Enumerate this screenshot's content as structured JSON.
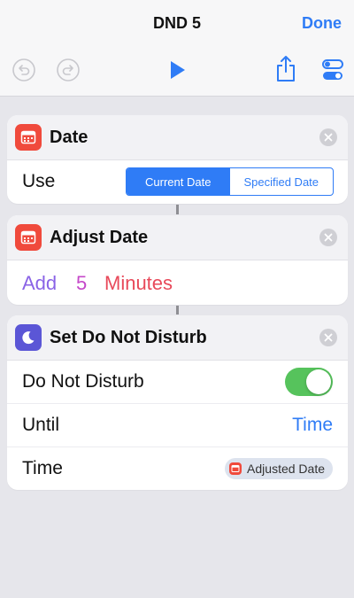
{
  "header": {
    "title": "DND 5",
    "done_label": "Done"
  },
  "toolbar": {
    "icons": [
      "undo-icon",
      "redo-icon",
      "play-icon",
      "share-icon",
      "settings-toggle-icon"
    ]
  },
  "actions": {
    "date": {
      "title": "Date",
      "icon": "calendar-icon",
      "use_label": "Use",
      "segments": [
        {
          "label": "Current Date",
          "selected": true
        },
        {
          "label": "Specified Date",
          "selected": false
        }
      ]
    },
    "adjust_date": {
      "title": "Adjust Date",
      "icon": "calendar-icon",
      "operation": "Add",
      "amount": "5",
      "unit": "Minutes"
    },
    "set_dnd": {
      "title": "Set Do Not Disturb",
      "icon": "moon-icon",
      "dnd_label": "Do Not Disturb",
      "dnd_on": true,
      "until_label": "Until",
      "until_value": "Time",
      "time_label": "Time",
      "time_value": "Adjusted Date"
    }
  },
  "colors": {
    "accent": "#2f7cf6",
    "calendar_icon": "#f04a3c",
    "moon_icon": "#5b56d6",
    "toggle_on": "#56c35c",
    "add_text": "#8a63e6",
    "amount_text": "#c548c9",
    "unit_text": "#e8495a"
  }
}
